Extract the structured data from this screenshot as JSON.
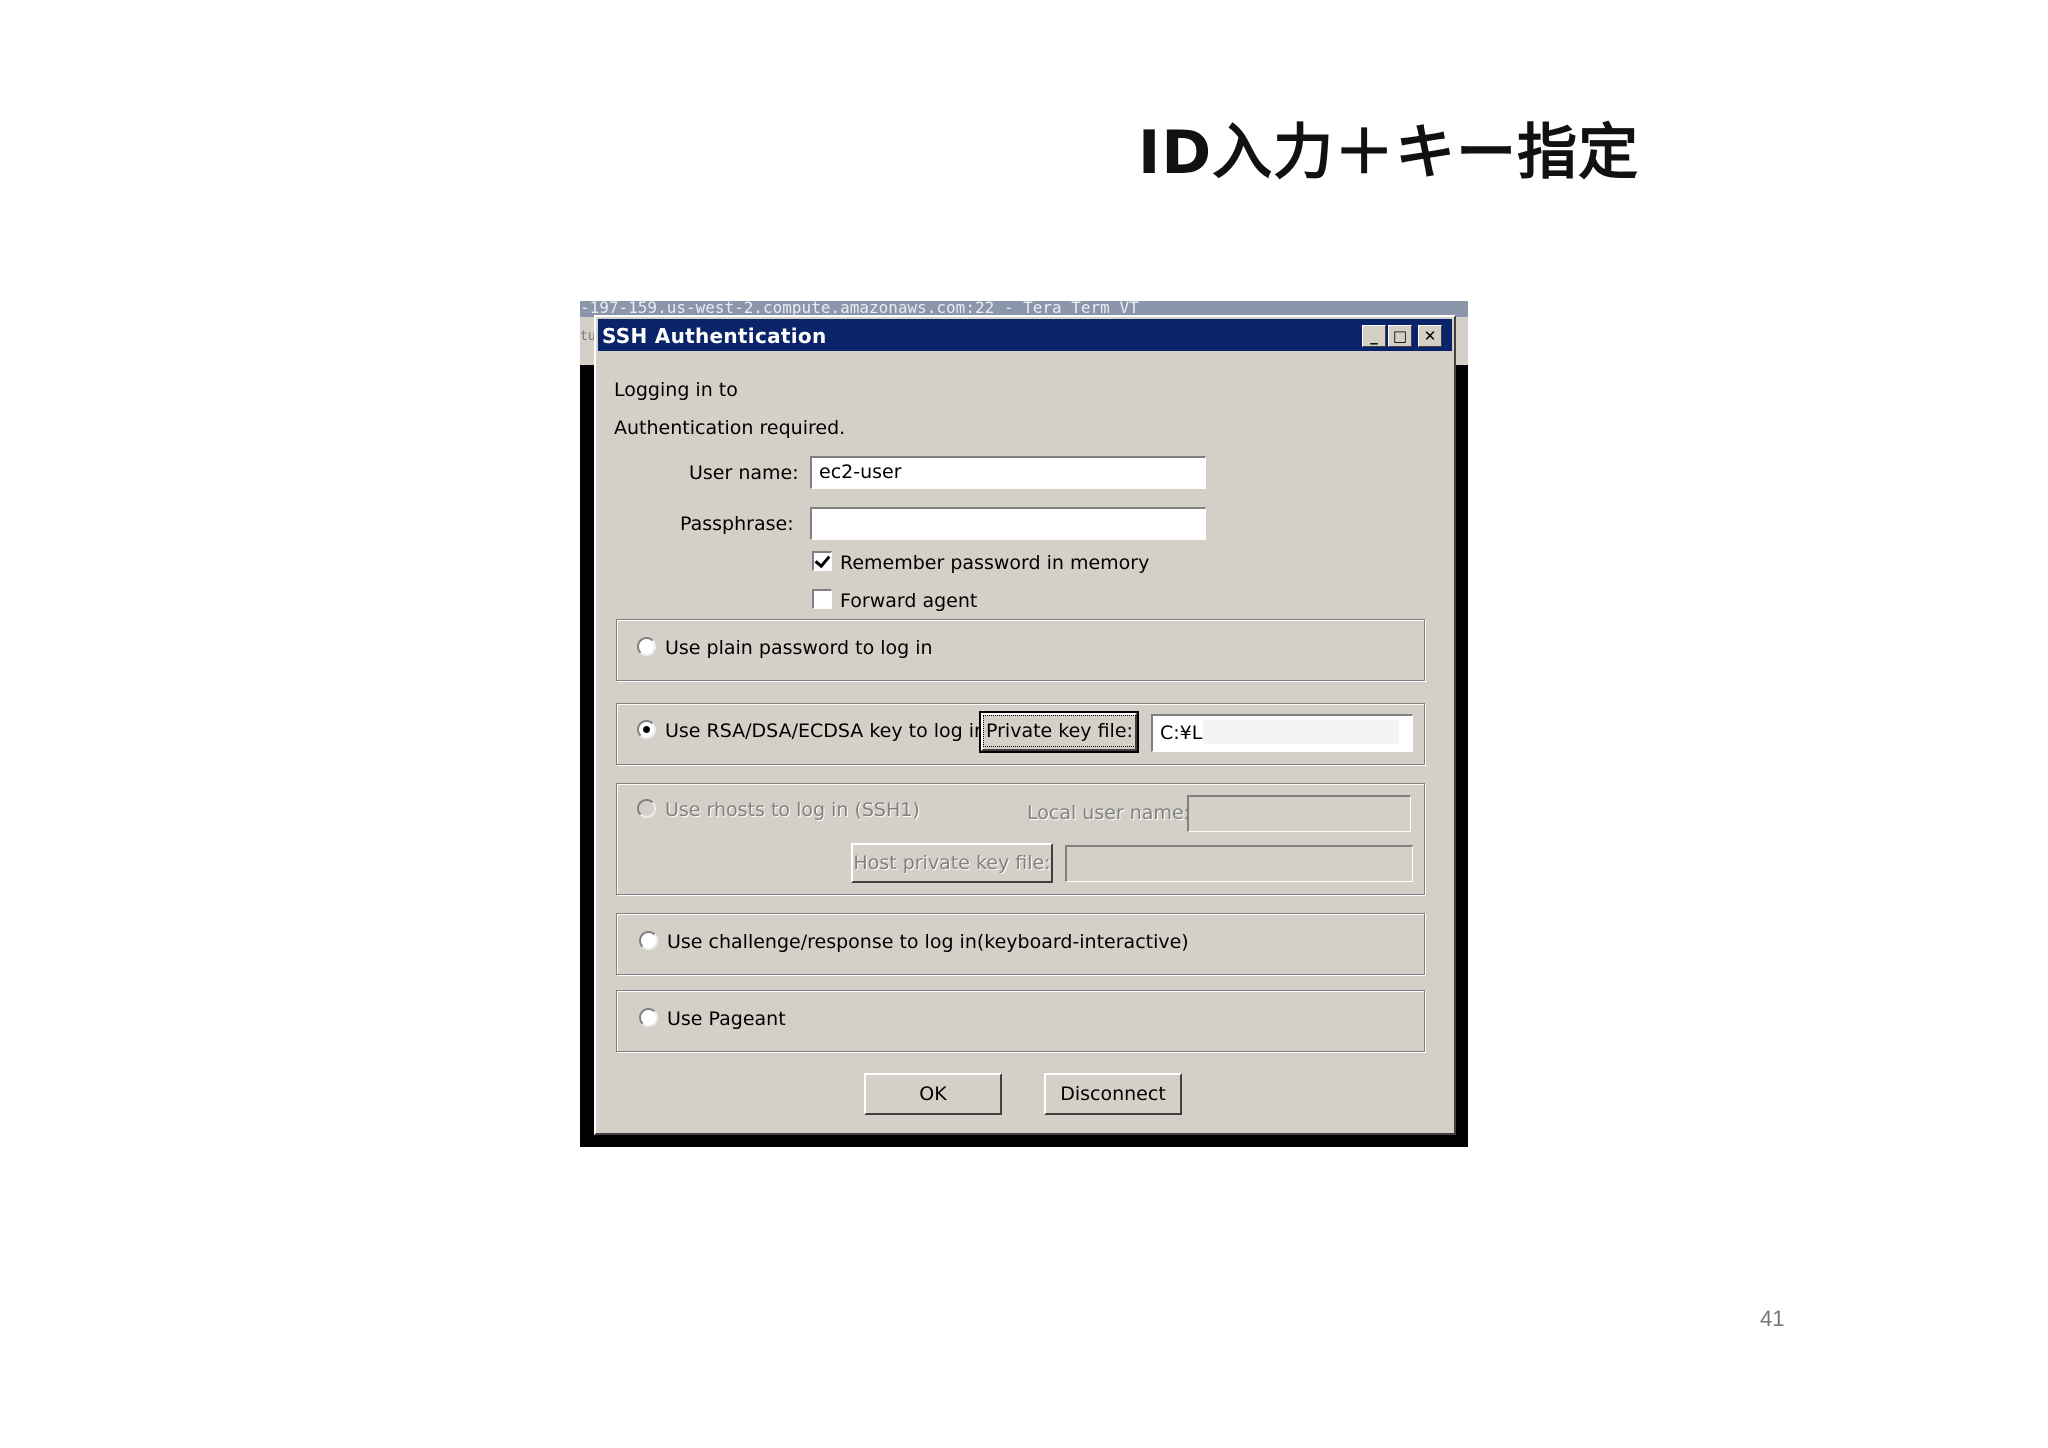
{
  "slide": {
    "title": "ID入力＋キー指定",
    "page_number": "41"
  },
  "terminal": {
    "title_fragment": "-197-159.us-west-2.compute.amazonaws.com:22 - Tera Term VT",
    "menu_fragment": "tu"
  },
  "dialog": {
    "title": "SSH Authentication",
    "logging_in_to": "Logging in to",
    "auth_required": "Authentication required.",
    "user_name_label": "User name:",
    "user_name_value": "ec2-user",
    "passphrase_label": "Passphrase:",
    "passphrase_value": "",
    "remember_password_label": "Remember password in memory",
    "remember_password_checked": true,
    "forward_agent_label": "Forward agent",
    "forward_agent_checked": false,
    "options": {
      "plain_password": "Use plain password to log in",
      "rsa_key": "Use RSA/DSA/ECDSA key to log in",
      "private_key_button": "Private key file:",
      "private_key_path": "C:¥L",
      "rhosts": "Use rhosts to log in (SSH1)",
      "local_user_label": "Local user name:",
      "host_key_button": "Host private key file:",
      "challenge": "Use challenge/response to log in(keyboard-interactive)",
      "pageant": "Use Pageant"
    },
    "selected_option": "rsa_key",
    "ok_button": "OK",
    "disconnect_button": "Disconnect"
  },
  "titlebar_buttons": {
    "minimize": "_",
    "maximize": "□",
    "close": "✕"
  },
  "colors": {
    "titlebar": "#0a246a",
    "dialog_bg": "#d4d0c8"
  }
}
